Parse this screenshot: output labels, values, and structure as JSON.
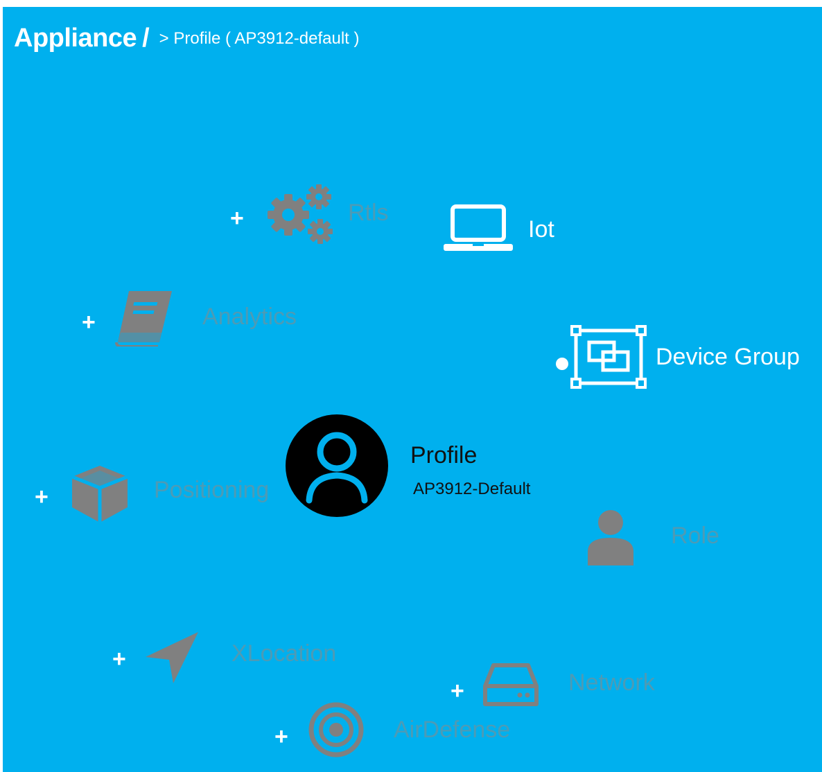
{
  "breadcrumb": {
    "root": "Appliance",
    "separator": "/",
    "current": "> Profile ( AP3912-default )"
  },
  "center": {
    "title": "Profile",
    "subtitle": "AP3912-Default",
    "icon": "user-circle-icon"
  },
  "nodes": {
    "rtls": {
      "label": "Rtls",
      "plus": "+",
      "icon": "gears-icon",
      "state": "collapsed"
    },
    "iot": {
      "label": "Iot",
      "icon": "laptop-icon",
      "state": "active"
    },
    "analytics": {
      "label": "Analytics",
      "plus": "+",
      "icon": "book-icon",
      "state": "collapsed"
    },
    "device_group": {
      "label": "Device Group",
      "icon": "device-group-icon",
      "state": "active"
    },
    "positioning": {
      "label": "Positioning",
      "plus": "+",
      "icon": "cube-icon",
      "state": "collapsed"
    },
    "role": {
      "label": "Role",
      "icon": "user-icon",
      "state": "inactive"
    },
    "xlocation": {
      "label": "XLocation",
      "plus": "+",
      "icon": "location-arrow-icon",
      "state": "collapsed"
    },
    "network": {
      "label": "Network",
      "plus": "+",
      "icon": "hard-drive-icon",
      "state": "collapsed"
    },
    "airdefense": {
      "label": "AirDefense",
      "plus": "+",
      "icon": "target-icon",
      "state": "collapsed"
    }
  },
  "colors": {
    "background": "#00b0ee",
    "active": "#ffffff",
    "inactive_icon": "#808080",
    "center": "#000000"
  }
}
